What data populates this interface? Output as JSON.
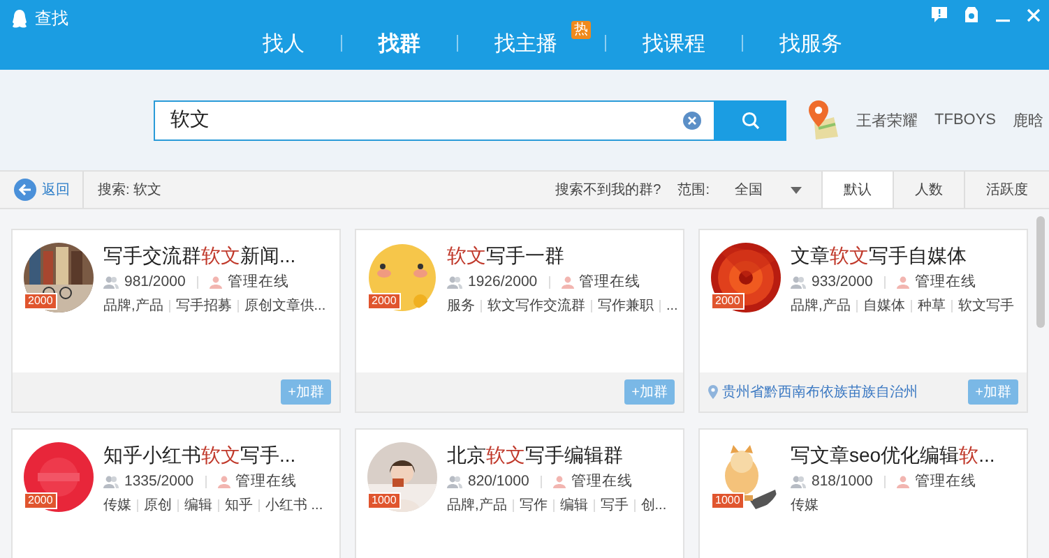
{
  "window": {
    "title": "查找"
  },
  "nav_tabs": [
    {
      "label": "找人",
      "selected": false
    },
    {
      "label": "找群",
      "selected": true
    },
    {
      "label": "找主播",
      "selected": false,
      "badge": "热"
    },
    {
      "label": "找课程",
      "selected": false
    },
    {
      "label": "找服务",
      "selected": false
    }
  ],
  "search": {
    "value": "软文"
  },
  "hot_words": [
    "王者荣耀",
    "TFBOYS",
    "鹿晗"
  ],
  "filter_bar": {
    "back": "返回",
    "query": "搜索: 软文",
    "help_link": "搜索不到我的群?",
    "range_label": "范围:",
    "range_value": "全国",
    "sort_tabs": [
      {
        "label": "默认",
        "selected": true
      },
      {
        "label": "人数",
        "selected": false
      },
      {
        "label": "活跃度",
        "selected": false
      }
    ]
  },
  "groups": [
    {
      "title": [
        {
          "text": "写手交流群",
          "highlight": false
        },
        {
          "text": "软文",
          "highlight": true
        },
        {
          "text": "新闻...",
          "highlight": false
        }
      ],
      "avatar_badge": "2000",
      "members": "981/2000",
      "admin_status": "管理在线",
      "tags": [
        "品牌,产品",
        "写手招募",
        "原创文章供..."
      ],
      "join_button": "+加群"
    },
    {
      "title": [
        {
          "text": "软文",
          "highlight": true
        },
        {
          "text": "写手一群",
          "highlight": false
        }
      ],
      "avatar_badge": "2000",
      "members": "1926/2000",
      "admin_status": "管理在线",
      "tags": [
        "服务",
        "软文写作交流群",
        "写作兼职",
        "..."
      ],
      "join_button": "+加群"
    },
    {
      "title": [
        {
          "text": "文章",
          "highlight": false
        },
        {
          "text": "软文",
          "highlight": true
        },
        {
          "text": "写手自媒体",
          "highlight": false
        }
      ],
      "avatar_badge": "2000",
      "members": "933/2000",
      "admin_status": "管理在线",
      "tags": [
        "品牌,产品",
        "自媒体",
        "种草",
        "软文写手"
      ],
      "location": "贵州省黔西南布依族苗族自治州",
      "join_button": "+加群"
    },
    {
      "title": [
        {
          "text": "知乎小红书",
          "highlight": false
        },
        {
          "text": "软文",
          "highlight": true
        },
        {
          "text": "写手...",
          "highlight": false
        }
      ],
      "avatar_badge": "2000",
      "members": "1335/2000",
      "admin_status": "管理在线",
      "tags": [
        "传媒",
        "原创",
        "编辑",
        "知乎",
        "小红书 ..."
      ]
    },
    {
      "title": [
        {
          "text": "北京",
          "highlight": false
        },
        {
          "text": "软文",
          "highlight": true
        },
        {
          "text": "写手编辑群",
          "highlight": false
        }
      ],
      "avatar_badge": "1000",
      "members": "820/1000",
      "admin_status": "管理在线",
      "tags": [
        "品牌,产品",
        "写作",
        "编辑",
        "写手",
        "创..."
      ]
    },
    {
      "title": [
        {
          "text": "写文章seo优化编辑",
          "highlight": false
        },
        {
          "text": "软",
          "highlight": true
        },
        {
          "text": "...",
          "highlight": false
        }
      ],
      "avatar_badge": "1000",
      "members": "818/1000",
      "admin_status": "管理在线",
      "tags": [
        "传媒"
      ]
    }
  ]
}
